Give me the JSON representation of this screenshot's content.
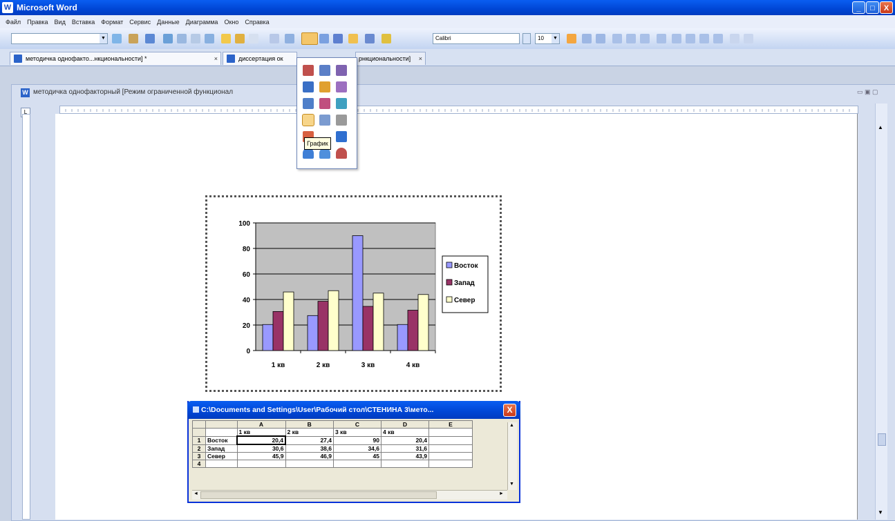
{
  "app": {
    "title": "Microsoft Word",
    "icon_letter": "W",
    "window_buttons": {
      "minimize": "_",
      "maximize": "□",
      "close": "X"
    }
  },
  "menu": [
    "Файл",
    "Правка",
    "Вид",
    "Вставка",
    "Формат",
    "Сервис",
    "Данные",
    "Диаграмма",
    "Окно",
    "Справка"
  ],
  "toolbar": {
    "font_name": "Calibri",
    "font_size": "10"
  },
  "tabs": [
    {
      "label": "методичка однофакто...нкциональности] *",
      "close": "×"
    },
    {
      "label": "диссертация ок",
      "close": ""
    },
    {
      "label": "рнкциональности]",
      "close": "×"
    }
  ],
  "document": {
    "title": "методичка однофакторный [Режим ограниченной функционал",
    "icon_letter": "W"
  },
  "chart_type_menu": {
    "tooltip": "График",
    "icon_colors": [
      "#c0504d",
      "#5b7fc7",
      "#7f63b0",
      "#3a6fc6",
      "#e0a030",
      "#9c6fc0",
      "#4f7fc9",
      "#c04f7f",
      "#3fa0c0",
      "#5b7fc7",
      "#7b9bd0",
      "#9a9a9a",
      "#d86040",
      "#c05050",
      "#2f6fd0",
      "#3f7fd6",
      "#4f8fdc"
    ]
  },
  "chart_data": {
    "type": "bar",
    "categories": [
      "1 кв",
      "2 кв",
      "3 кв",
      "4 кв"
    ],
    "series": [
      {
        "name": "Восток",
        "values": [
          20.4,
          27.4,
          90,
          20.4
        ],
        "color": "#9999ff"
      },
      {
        "name": "Запад",
        "values": [
          30.6,
          38.6,
          34.6,
          31.6
        ],
        "color": "#993366"
      },
      {
        "name": "Север",
        "values": [
          45.9,
          46.9,
          45,
          43.9
        ],
        "color": "#ffffcc"
      }
    ],
    "yticks": [
      "0",
      "20",
      "40",
      "60",
      "80",
      "100"
    ],
    "ylim": [
      0,
      100
    ],
    "grid": true,
    "plot_background": "#c0c0c0",
    "legend_position": "right"
  },
  "datasheet": {
    "title": "C:\\Documents and Settings\\User\\Рабочий стол\\СТЕНИНА 3\\мето...",
    "close": "X",
    "columns": [
      "A",
      "B",
      "C",
      "D",
      "E"
    ],
    "header_row": [
      "1 кв",
      "2 кв",
      "3 кв",
      "4 кв",
      ""
    ],
    "rows": [
      {
        "num": "1",
        "label": "Восток",
        "values": [
          "20,4",
          "27,4",
          "90",
          "20,4",
          ""
        ]
      },
      {
        "num": "2",
        "label": "Запад",
        "values": [
          "30,6",
          "38,6",
          "34,6",
          "31,6",
          ""
        ]
      },
      {
        "num": "3",
        "label": "Север",
        "values": [
          "45,9",
          "46,9",
          "45",
          "43,9",
          ""
        ]
      },
      {
        "num": "4",
        "label": "",
        "values": [
          "",
          "",
          "",
          "",
          ""
        ]
      }
    ]
  }
}
